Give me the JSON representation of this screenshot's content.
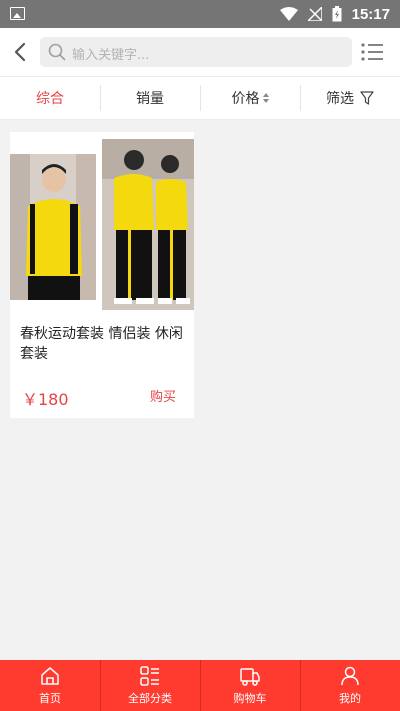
{
  "status_bar": {
    "time": "15:17"
  },
  "header": {
    "search_placeholder": "输入关键字..."
  },
  "tabs": [
    {
      "label": "综合",
      "active": true
    },
    {
      "label": "销量",
      "active": false
    },
    {
      "label": "价格",
      "active": false
    },
    {
      "label": "筛选",
      "active": false
    }
  ],
  "products": [
    {
      "name": "春秋运动套装 情侣装 休闲套装",
      "price": "￥180",
      "buy_label": "购买"
    }
  ],
  "bottom_nav": [
    {
      "label": "首页",
      "icon": "home-icon"
    },
    {
      "label": "全部分类",
      "icon": "category-icon"
    },
    {
      "label": "购物车",
      "icon": "cart-truck-icon"
    },
    {
      "label": "我的",
      "icon": "user-icon"
    }
  ],
  "colors": {
    "accent": "#e64545",
    "nav_bg": "#ff3b30",
    "status_bar": "#757575"
  }
}
